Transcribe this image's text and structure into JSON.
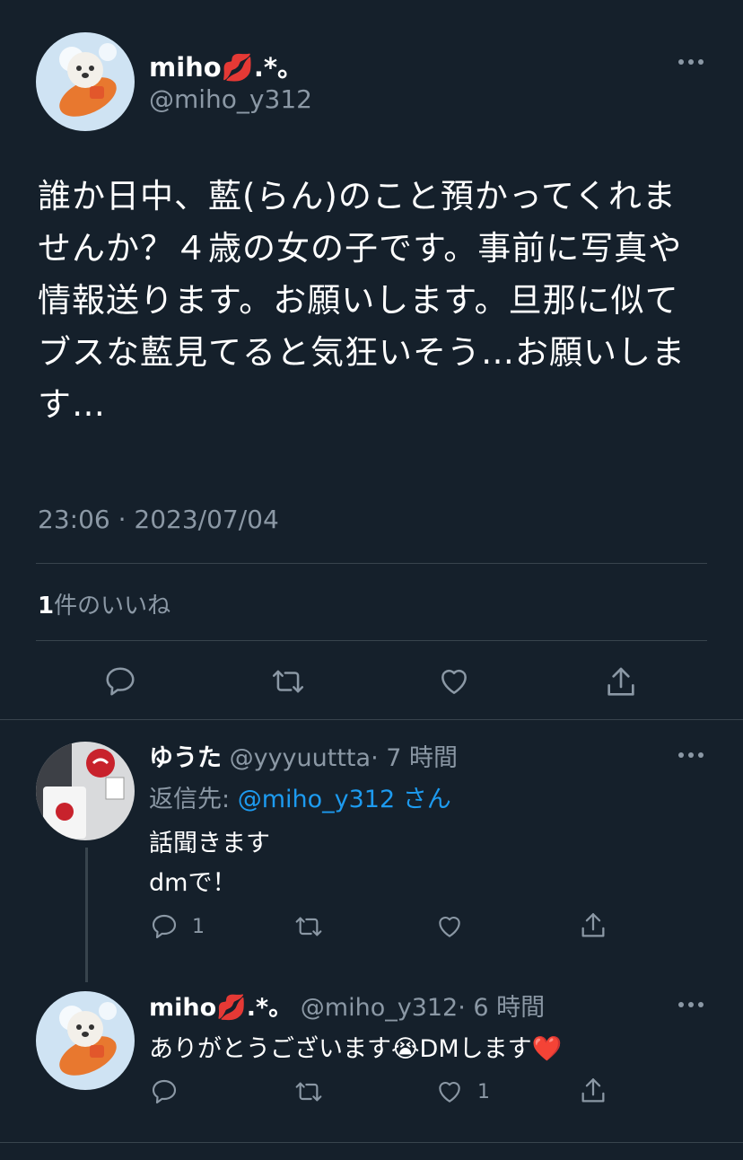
{
  "main_tweet": {
    "display_name": "miho",
    "name_emoji": "💋",
    "name_suffix": ".*。",
    "handle": "@miho_y312",
    "text": "誰か日中、藍(らん)のこと預かってくれませんか？４歳の女の子です。事前に写真や情報送ります。お願いします。旦那に似てブスな藍見てると気狂いそう…お願いします…",
    "timestamp": "23:06 · 2023/07/04",
    "likes_count": "1",
    "likes_label": "件のいいね"
  },
  "reply1": {
    "display_name": "ゆうた",
    "handle": "@yyyuuttta",
    "time": "· 7 時間",
    "reply_to_prefix": "返信先:",
    "reply_to_handle": "@miho_y312",
    "reply_to_suffix": "さん",
    "text_line1": "話聞きます",
    "text_line2": "dmで！",
    "reply_count": "1",
    "like_count": ""
  },
  "reply2": {
    "display_name": "miho",
    "name_emoji": "💋",
    "name_suffix": ".*。",
    "handle": "@miho_y312",
    "time": "· 6 時間",
    "text": "ありがとうございます😭DMします❤️",
    "reply_count": "",
    "like_count": "1"
  },
  "colors": {
    "background": "#15202b",
    "text": "#ffffff",
    "muted": "#8b98a5",
    "link": "#1d9bf0",
    "divider": "#38444d"
  },
  "icons": {
    "more": "more-dots-icon",
    "reply": "reply-bubble-icon",
    "retweet": "retweet-icon",
    "like": "heart-icon",
    "share": "share-upload-icon"
  }
}
